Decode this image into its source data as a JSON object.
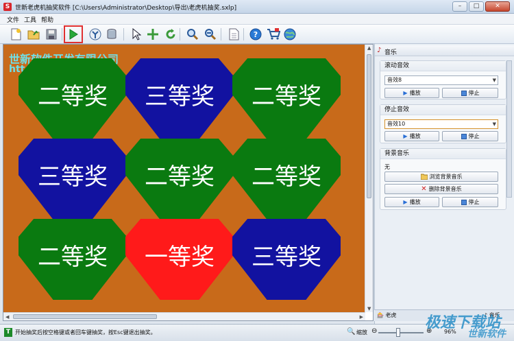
{
  "window": {
    "title": "世新老虎机抽奖软件 [C:\\Users\\Administrator\\Desktop\\导出\\老虎机抽奖.sxlp]",
    "min": "–",
    "max": "□",
    "close": "✕"
  },
  "menu": [
    "文件",
    "工具",
    "帮助"
  ],
  "toolbar": {
    "icons": [
      "new-icon",
      "open-icon",
      "save-icon",
      "start-icon",
      "import-icon",
      "database-icon",
      "pointer-icon",
      "move-icon",
      "rotate-icon",
      "zoom-in-icon",
      "zoom-out-icon",
      "page-icon",
      "help-icon",
      "cart-icon",
      "web-icon"
    ]
  },
  "canvas": {
    "company_line1": "世新软件开发有限公司",
    "company_line2": "htt",
    "prizes": [
      {
        "label": "二等奖",
        "color": "green"
      },
      {
        "label": "三等奖",
        "color": "blue"
      },
      {
        "label": "二等奖",
        "color": "green"
      },
      {
        "label": "三等奖",
        "color": "blue"
      },
      {
        "label": "二等奖",
        "color": "green"
      },
      {
        "label": "二等奖",
        "color": "green"
      },
      {
        "label": "二等奖",
        "color": "green"
      },
      {
        "label": "一等奖",
        "color": "red"
      },
      {
        "label": "三等奖",
        "color": "blue"
      }
    ],
    "colors": {
      "background": "#c86a1a",
      "green": "#0a7a10",
      "blue": "#1212a0",
      "red": "#ff1a1a"
    }
  },
  "panel": {
    "header": "音乐",
    "rolling": {
      "title": "滚动音效",
      "selected": "音效8",
      "play": "播放",
      "stop": "停止"
    },
    "stop_sound": {
      "title": "停止音效",
      "selected": "音效10",
      "play": "播放",
      "stop": "停止"
    },
    "bgm": {
      "title": "背景音乐",
      "value": "无",
      "browse": "浏览背景音乐",
      "delete": "删除背景音乐",
      "play": "播放",
      "stop": "停止"
    },
    "tabs": [
      "老虎",
      "音乐"
    ]
  },
  "status": {
    "text": "开始抽奖后按空格键或者回车键抽奖，按Esc键退出抽奖。",
    "zoom_label": "缩放",
    "zoom_value": "96%"
  },
  "watermark": {
    "line1": "极速下载站",
    "line2": "世新软件"
  }
}
